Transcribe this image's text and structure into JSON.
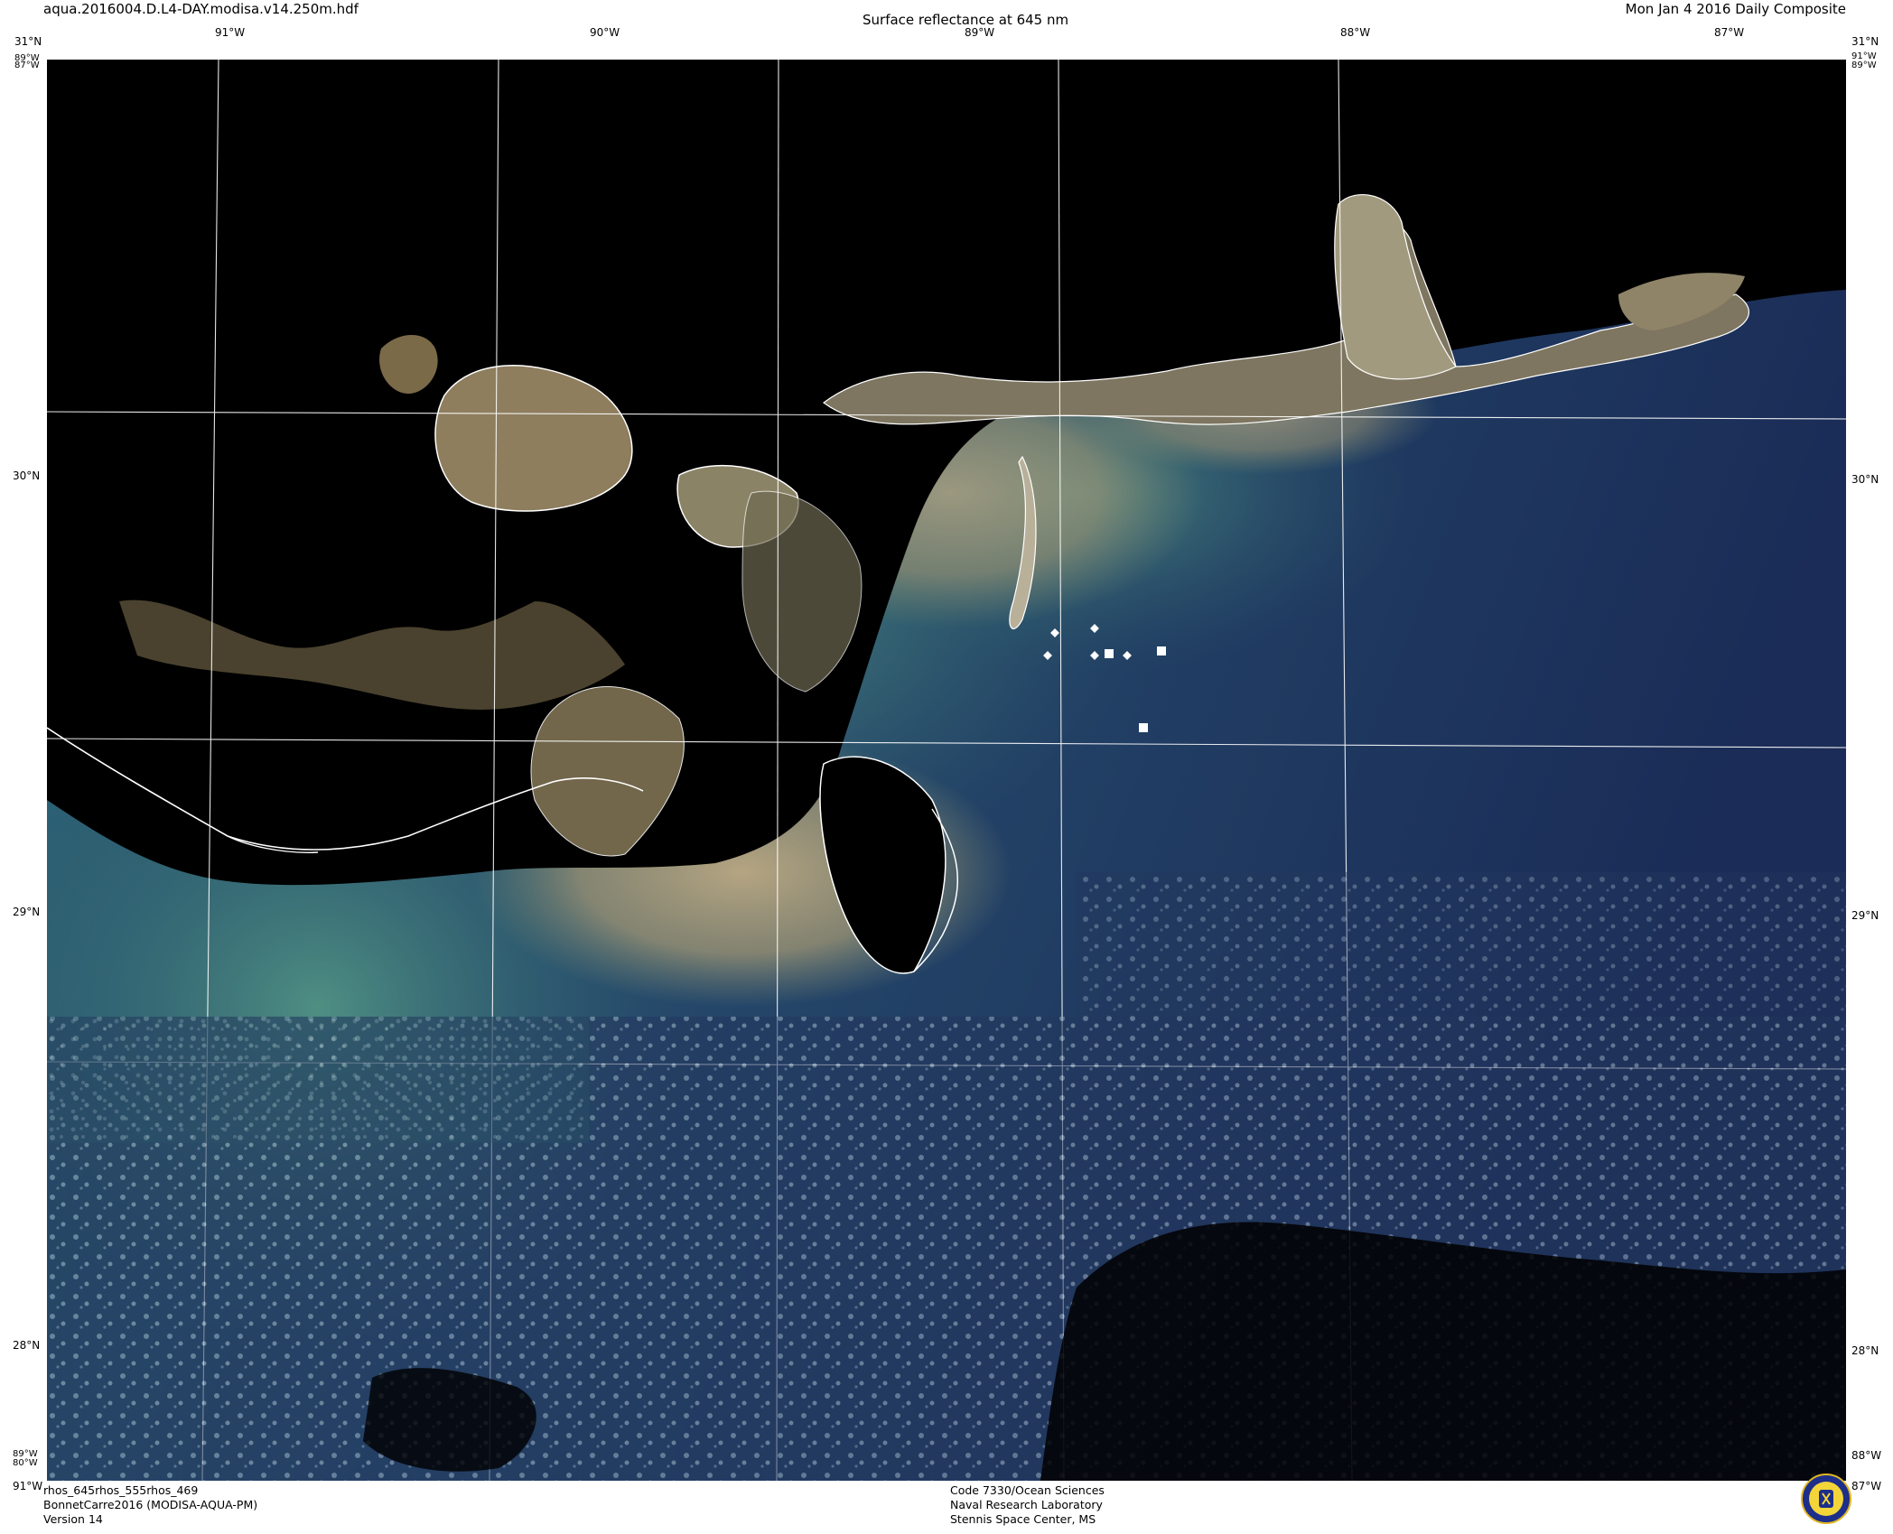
{
  "header": {
    "filename": "aqua.2016004.D.L4-DAY.modisa.v14.250m.hdf",
    "product": "Surface reflectance at 645 nm",
    "date": "Mon Jan  4 2016 Daily Composite"
  },
  "axes": {
    "lon_top": [
      "91°W",
      "90°W",
      "89°W",
      "88°W",
      "87°W"
    ],
    "lat_side": [
      "30°N",
      "29°N",
      "28°N"
    ],
    "corner_top_left": [
      "31°N",
      "89°W",
      "87°W"
    ],
    "corner_top_right": [
      "31°N",
      "91°W",
      "89°W"
    ],
    "corner_bottom_left": [
      "89°W",
      "80°W",
      "91°W"
    ],
    "corner_bottom_right": [
      "88°W",
      "87°W"
    ]
  },
  "footer": {
    "left": [
      "rhos_645rhos_555rhos_469",
      "BonnetCarre2016 (MODISA-AQUA-PM)",
      "Version 14"
    ],
    "center": [
      "Code 7330/Ocean Sciences",
      "Naval Research Laboratory",
      "Stennis Space Center, MS"
    ]
  },
  "map": {
    "ocean_deep": "#1c2e58",
    "ocean_turbid": "#3f7a70",
    "sediment": "#a99c7c",
    "land_masked": "#000000",
    "coastline": "#ffffff",
    "markers": [
      "diamond",
      "diamond",
      "diamond",
      "diamond",
      "diamond",
      "square",
      "square",
      "square"
    ]
  },
  "seal_icon": "navy-seal-icon"
}
